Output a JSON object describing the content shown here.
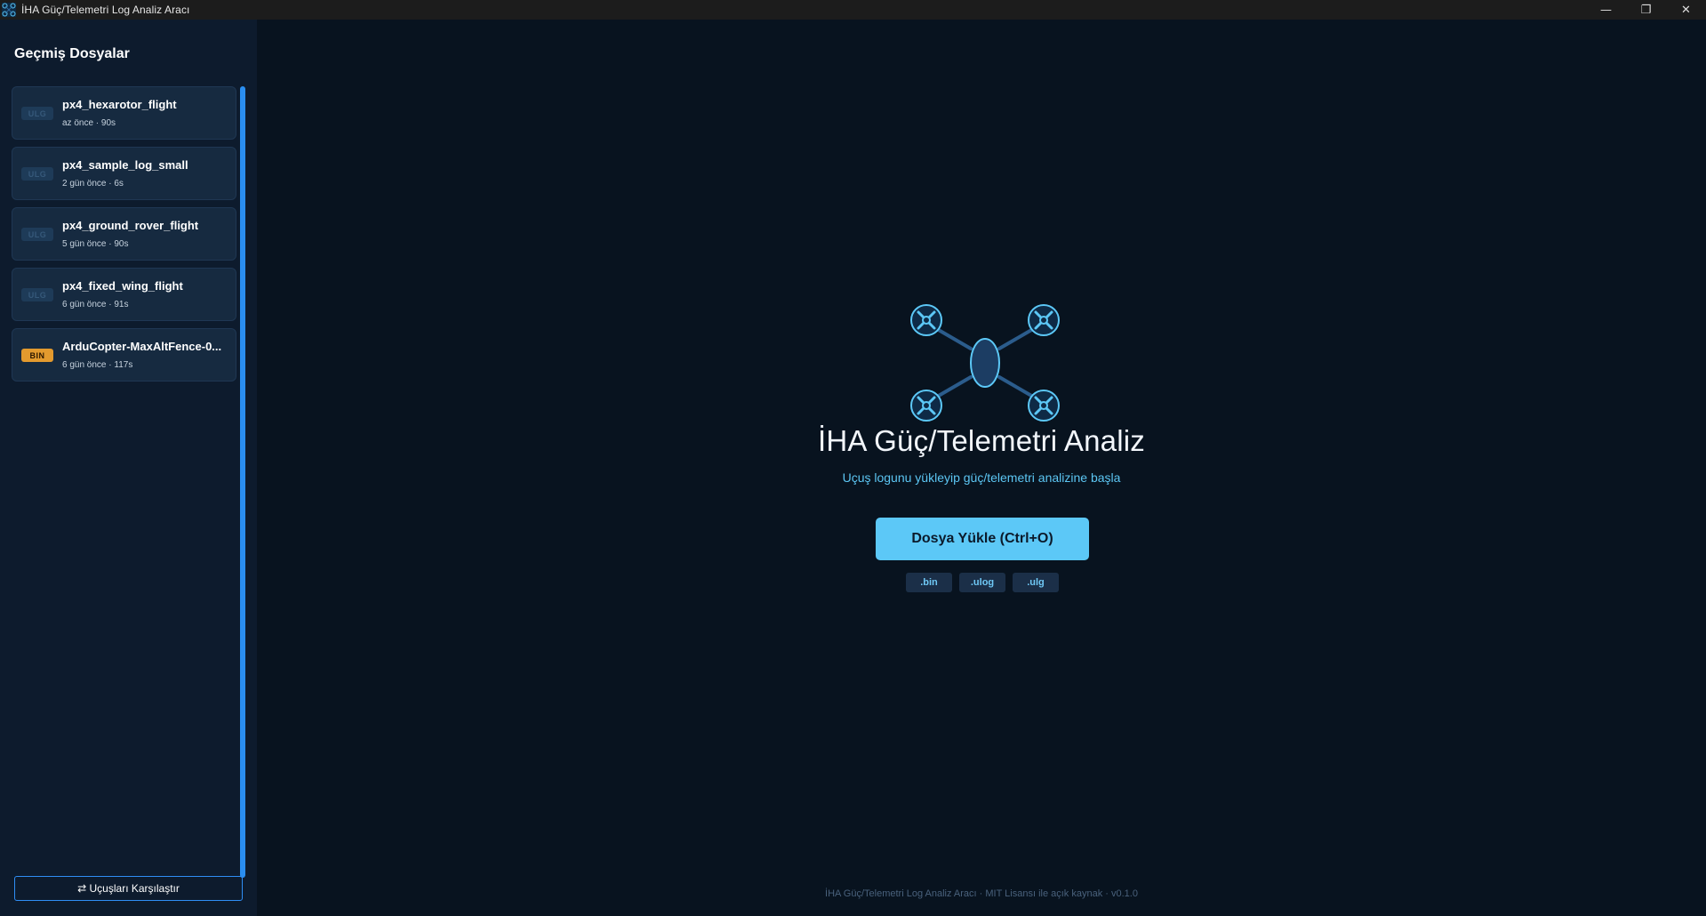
{
  "window": {
    "title": "İHA Güç/Telemetri Log Analiz Aracı",
    "controls": {
      "minimize": "—",
      "restore": "❐",
      "close": "✕"
    }
  },
  "sidebar": {
    "title": "Geçmiş Dosyalar",
    "items": [
      {
        "badge": "ULG",
        "name": "px4_hexarotor_flight",
        "meta": "az önce · 90s"
      },
      {
        "badge": "ULG",
        "name": "px4_sample_log_small",
        "meta": "2 gün önce · 6s"
      },
      {
        "badge": "ULG",
        "name": "px4_ground_rover_flight",
        "meta": "5 gün önce · 90s"
      },
      {
        "badge": "ULG",
        "name": "px4_fixed_wing_flight",
        "meta": "6 gün önce · 91s"
      },
      {
        "badge": "BIN",
        "name": "ArduCopter-MaxAltFence-0...",
        "meta": "6 gün önce · 117s"
      }
    ],
    "compare_button": "⇄ Uçuşları Karşılaştır"
  },
  "main": {
    "icon": "drone-icon",
    "title": "İHA Güç/Telemetri Analiz",
    "subtitle": "Uçuş logunu yükleyip güç/telemetri analizine başla",
    "load_button": "Dosya Yükle (Ctrl+O)",
    "extensions": [
      ".bin",
      ".ulog",
      ".ulg"
    ],
    "footer": "İHA Güç/Telemetri Log Analiz Aracı · MIT Lisansı ile açık kaynak · v0.1.0"
  },
  "colors": {
    "background": "#08131f",
    "sidebar": "#0d1b2d",
    "accent": "#5cc8f7",
    "scrollbar": "#2a8ef0",
    "bin_badge": "#e39a2e"
  }
}
